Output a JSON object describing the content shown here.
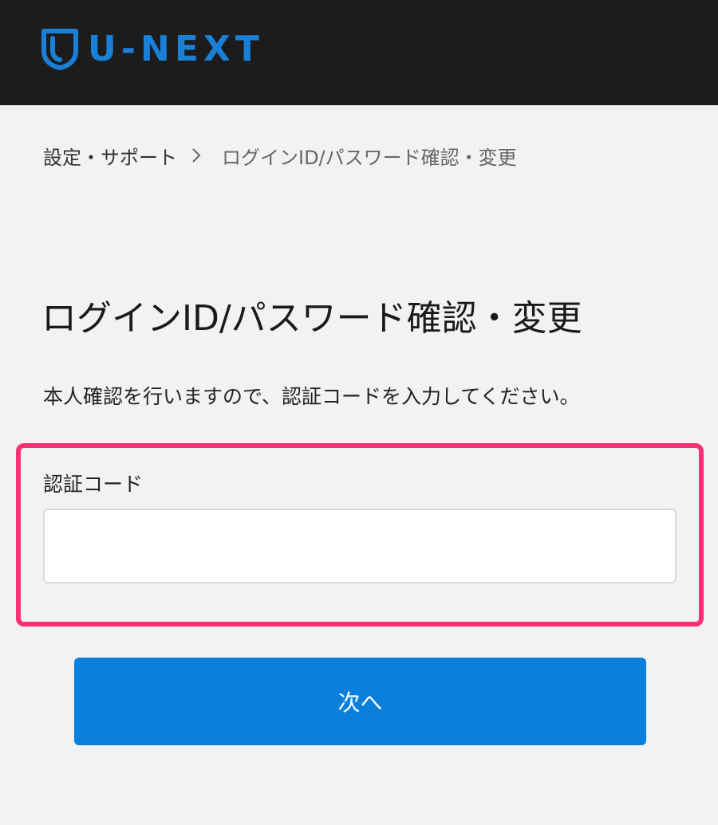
{
  "header": {
    "logo": {
      "icon": "u-next-shield-icon",
      "text": "U-NEXT",
      "color": "#1a7fd6"
    },
    "background": "#1c1c1c"
  },
  "breadcrumb": {
    "parent": "設定・サポート",
    "separator_icon": "chevron-right-icon",
    "current": "ログインID/パスワード確認・変更"
  },
  "main": {
    "title": "ログインID/パスワード確認・変更",
    "description": "本人確認を行いますので、認証コードを入力してください。",
    "form": {
      "code_label": "認証コード",
      "code_value": "",
      "code_placeholder": ""
    },
    "next_button_label": "次へ"
  },
  "colors": {
    "accent": "#0a80dc",
    "highlight": "#ff2f73",
    "page_background": "#f2f2f2"
  }
}
